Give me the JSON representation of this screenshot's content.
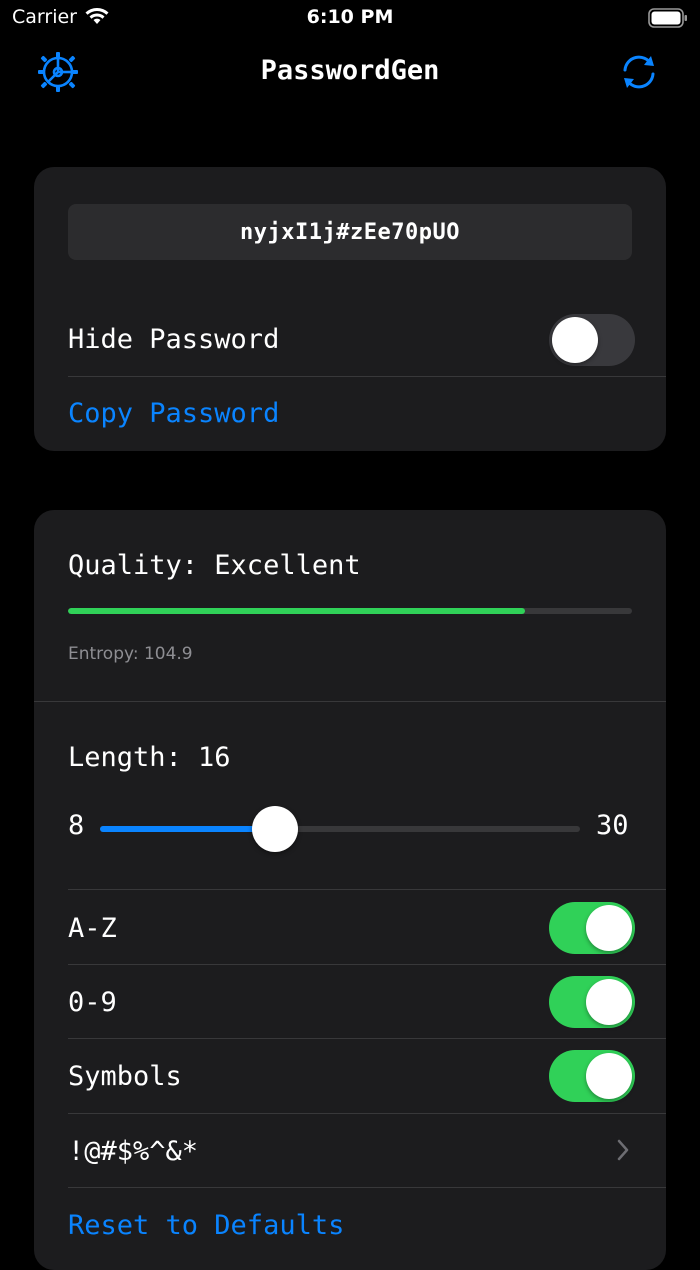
{
  "status_bar": {
    "carrier": "Carrier",
    "time": "6:10 PM"
  },
  "nav": {
    "title": "PasswordGen",
    "left_icon": "gear-icon",
    "right_icon": "refresh-icon"
  },
  "password_card": {
    "password": "nyjxI1j#zEe70pUO",
    "hide_label": "Hide Password",
    "hide_enabled": false,
    "copy_label": "Copy Password"
  },
  "settings_card": {
    "quality_label": "Quality: Excellent",
    "quality_fraction": 0.81,
    "entropy_label": "Entropy: 104.9",
    "length_label": "Length: 16",
    "slider": {
      "min": "8",
      "max": "30",
      "value": 16
    },
    "options": [
      {
        "label": "A-Z",
        "enabled": true
      },
      {
        "label": "0-9",
        "enabled": true
      },
      {
        "label": "Symbols",
        "enabled": true
      }
    ],
    "symbols_set": "!@#$%^&*",
    "reset_label": "Reset to Defaults"
  },
  "colors": {
    "accent": "#0a84ff",
    "toggle_on": "#30d158",
    "card_bg": "#1c1c1e",
    "background": "#000000"
  }
}
